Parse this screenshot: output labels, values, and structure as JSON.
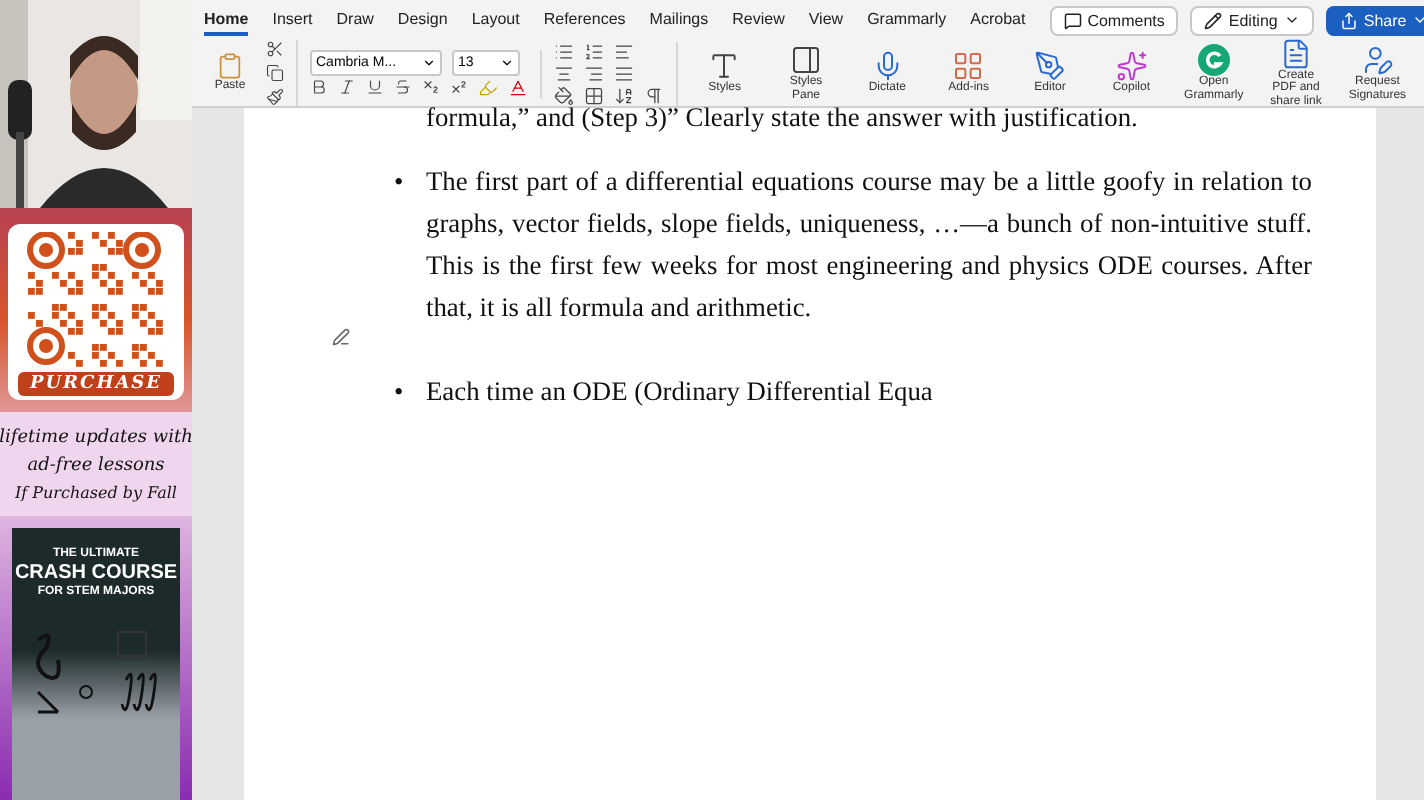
{
  "promo": {
    "qr_caption": "PURCHASE",
    "lines": [
      "lifetime updates with",
      "ad-free lessons",
      "If Purchased by Fall"
    ],
    "book": {
      "kicker": "THE ULTIMATE",
      "title": "CRASH COURSE",
      "subtitle": "FOR STEM MAJORS"
    }
  },
  "tabs": [
    {
      "label": "Home",
      "selected": true
    },
    {
      "label": "Insert",
      "selected": false
    },
    {
      "label": "Draw",
      "selected": false
    },
    {
      "label": "Design",
      "selected": false
    },
    {
      "label": "Layout",
      "selected": false
    },
    {
      "label": "References",
      "selected": false
    },
    {
      "label": "Mailings",
      "selected": false
    },
    {
      "label": "Review",
      "selected": false
    },
    {
      "label": "View",
      "selected": false
    },
    {
      "label": "Grammarly",
      "selected": false
    },
    {
      "label": "Acrobat",
      "selected": false
    }
  ],
  "header_buttons": [
    {
      "kind": "comments",
      "label": "Comments"
    },
    {
      "kind": "editing",
      "label": "Editing"
    },
    {
      "kind": "share",
      "label": "Share"
    }
  ],
  "ribbon": {
    "paste": "Paste",
    "font": "Cambria M...",
    "size": "13",
    "tools": [
      {
        "kind": "styles",
        "label": "Styles"
      },
      {
        "kind": "pane",
        "label": "Styles Pane"
      },
      {
        "kind": "dictate",
        "label": "Dictate"
      },
      {
        "kind": "addins",
        "label": "Add-ins"
      },
      {
        "kind": "editor",
        "label": "Editor"
      },
      {
        "kind": "copilot",
        "label": "Copilot"
      },
      {
        "kind": "grammarly",
        "label": "Open Grammarly"
      },
      {
        "kind": "pdf",
        "label": "Create PDF and share link"
      },
      {
        "kind": "sign",
        "label": "Request Signatures"
      }
    ]
  },
  "document": {
    "top_line": "formula,” and (Step 3)” Clearly state the answer with justification.",
    "bullets": [
      {
        "marker": "•",
        "text": "The first part of a differential equations course may be a little goofy in relation to graphs, vector fields, slope fields, uniqueness, …—a bunch of non-intuitive stuff. This is the first few weeks for most engineering and physics ODE courses. After that, it is all formula and arithmetic."
      },
      {
        "marker": "•",
        "text": "Each time an ODE (Ordinary Differential Equa"
      }
    ]
  }
}
